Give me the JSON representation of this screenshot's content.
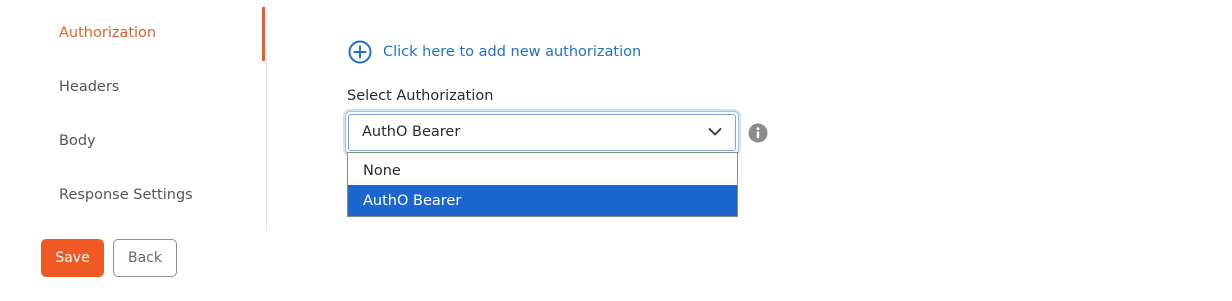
{
  "sidebar": {
    "items": [
      {
        "label": "Authorization",
        "active": true
      },
      {
        "label": "Headers",
        "active": false
      },
      {
        "label": "Body",
        "active": false
      },
      {
        "label": "Response Settings",
        "active": false
      }
    ]
  },
  "actions": {
    "save_label": "Save",
    "back_label": "Back"
  },
  "main": {
    "add_link_label": "Click here to add new authorization",
    "select_label": "Select Authorization",
    "select_value": "AuthO Bearer",
    "options": [
      {
        "label": "None",
        "selected": false
      },
      {
        "label": "AuthO Bearer",
        "selected": true
      }
    ]
  },
  "colors": {
    "accent": "#ea5b2b",
    "link": "#1f6fd6",
    "selected_option": "#1c66d0"
  },
  "icons": {
    "add": "plus-circle-icon",
    "chevron": "chevron-down-icon",
    "info": "info-icon"
  }
}
